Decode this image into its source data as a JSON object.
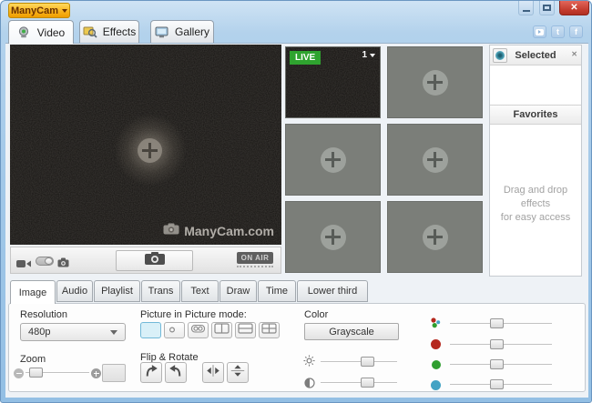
{
  "window": {
    "app_button": "ManyCam",
    "close_glyph": "✕"
  },
  "tabs": {
    "video": "Video",
    "effects": "Effects",
    "gallery": "Gallery"
  },
  "social": {
    "twitter": "t",
    "facebook": "f"
  },
  "video": {
    "watermark": "ManyCam.com",
    "on_air": "ON AIR"
  },
  "live": {
    "badge": "LIVE",
    "source": "1"
  },
  "sidebar": {
    "selected": "Selected",
    "close_glyph": "✕",
    "favorites": "Favorites",
    "hint_line1": "Drag and drop effects",
    "hint_line2": "for easy access"
  },
  "bottom_tabs": {
    "image": "Image",
    "audio": "Audio",
    "playlist": "Playlist",
    "trans": "Trans",
    "text": "Text",
    "draw": "Draw",
    "time": "Time",
    "lower_third": "Lower third"
  },
  "panel": {
    "resolution_label": "Resolution",
    "resolution_value": "480p",
    "zoom_label": "Zoom",
    "pip_label": "Picture in Picture mode:",
    "flip_label": "Flip & Rotate",
    "color_label": "Color",
    "grayscale_button": "Grayscale"
  },
  "colors": {
    "live_green": "#2fa32f",
    "frame_blue": "#a7cbe9",
    "pip_selected": "#d9f0f8",
    "red_dot": "#b5281e",
    "green_dot": "#2f9e2f",
    "blue_dot": "#44a3c4",
    "rgb_cluster": "red+green+blue"
  }
}
